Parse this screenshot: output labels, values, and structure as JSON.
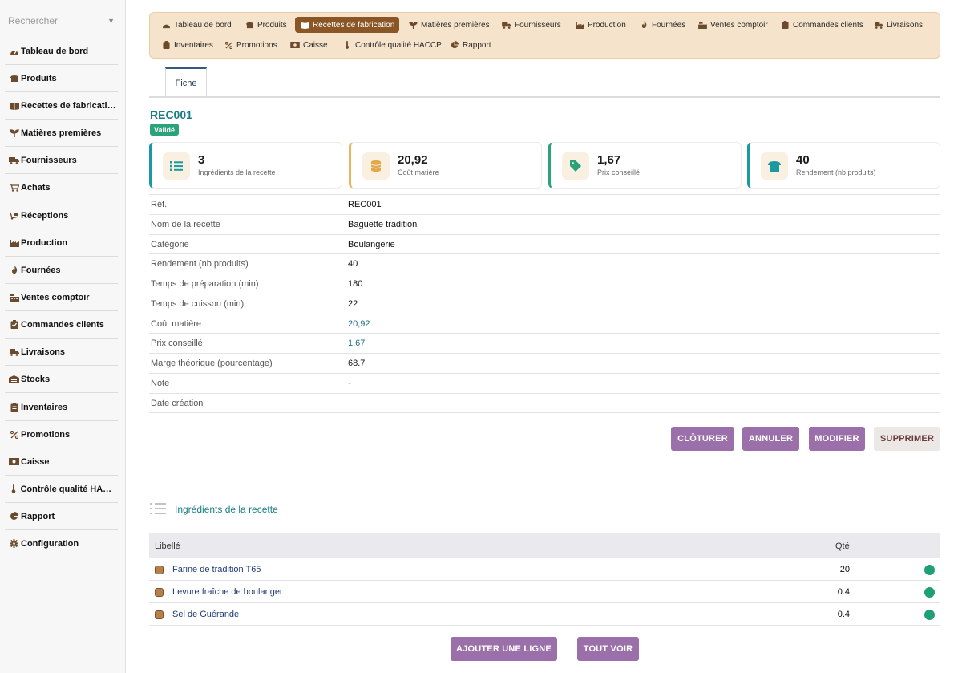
{
  "sidebar": {
    "search_placeholder": "Rechercher",
    "items": [
      {
        "label": "Tableau de bord",
        "icon": "dashboard-icon"
      },
      {
        "label": "Produits",
        "icon": "bread-icon"
      },
      {
        "label": "Recettes de fabrication",
        "icon": "book-icon"
      },
      {
        "label": "Matières premières",
        "icon": "seedling-icon"
      },
      {
        "label": "Fournisseurs",
        "icon": "truck-icon"
      },
      {
        "label": "Achats",
        "icon": "cart-icon"
      },
      {
        "label": "Réceptions",
        "icon": "dolly-icon"
      },
      {
        "label": "Production",
        "icon": "industry-icon"
      },
      {
        "label": "Fournées",
        "icon": "fire-icon"
      },
      {
        "label": "Ventes comptoir",
        "icon": "cash-register-icon"
      },
      {
        "label": "Commandes clients",
        "icon": "clipboard-check-icon"
      },
      {
        "label": "Livraisons",
        "icon": "shipping-fast-icon"
      },
      {
        "label": "Stocks",
        "icon": "warehouse-icon"
      },
      {
        "label": "Inventaires",
        "icon": "clipboard-list-icon"
      },
      {
        "label": "Promotions",
        "icon": "percent-icon"
      },
      {
        "label": "Caisse",
        "icon": "money-icon"
      },
      {
        "label": "Contrôle qualité HACCP",
        "icon": "thermometer-icon"
      },
      {
        "label": "Rapport",
        "icon": "chart-pie-icon"
      },
      {
        "label": "Configuration",
        "icon": "gear-icon"
      }
    ]
  },
  "topnav": {
    "items": [
      {
        "label": "Tableau de bord",
        "icon": "dashboard-icon"
      },
      {
        "label": "Produits",
        "icon": "bread-icon"
      },
      {
        "label": "Recettes de fabrication",
        "icon": "book-icon",
        "active": true
      },
      {
        "label": "Matières premières",
        "icon": "seedling-icon"
      },
      {
        "label": "Fournisseurs",
        "icon": "truck-icon"
      },
      {
        "label": "Production",
        "icon": "industry-icon"
      },
      {
        "label": "Fournées",
        "icon": "fire-icon"
      },
      {
        "label": "Ventes comptoir",
        "icon": "cash-register-icon"
      },
      {
        "label": "Commandes clients",
        "icon": "clipboard-check-icon"
      },
      {
        "label": "Livraisons",
        "icon": "shipping-fast-icon"
      },
      {
        "label": "Inventaires",
        "icon": "clipboard-list-icon"
      },
      {
        "label": "Promotions",
        "icon": "percent-icon"
      },
      {
        "label": "Caisse",
        "icon": "money-icon"
      },
      {
        "label": "Contrôle qualité HACCP",
        "icon": "thermometer-icon"
      },
      {
        "label": "Rapport",
        "icon": "chart-pie-icon"
      }
    ]
  },
  "tabs": {
    "fiche": "Fiche"
  },
  "record": {
    "ref": "REC001",
    "status": "Validé"
  },
  "kpis": [
    {
      "value": "3",
      "label": "Ingrédients de la recette",
      "icon": "list-icon",
      "accent": "#1a9aa0"
    },
    {
      "value": "20,92",
      "label": "Coût matière",
      "icon": "coins-icon",
      "accent": "#e8b560"
    },
    {
      "value": "1,67",
      "label": "Prix conseillé",
      "icon": "tag-icon",
      "accent": "#2aa27a"
    },
    {
      "value": "40",
      "label": "Rendement (nb produits)",
      "icon": "bread-icon",
      "accent": "#1a9aa0"
    }
  ],
  "details": [
    {
      "key": "Réf.",
      "value": "REC001"
    },
    {
      "key": "Nom de la recette",
      "value": "Baguette tradition"
    },
    {
      "key": "Catégorie",
      "value": "Boulangerie"
    },
    {
      "key": "Rendement (nb produits)",
      "value": "40"
    },
    {
      "key": "Temps de préparation (min)",
      "value": "180"
    },
    {
      "key": "Temps de cuisson (min)",
      "value": "22"
    },
    {
      "key": "Coût matière",
      "value": "20,92"
    },
    {
      "key": "Prix conseillé",
      "value": "1,67"
    },
    {
      "key": "Marge théorique (pourcentage)",
      "value": "68.7"
    },
    {
      "key": "Note",
      "value": "-"
    },
    {
      "key": "Date création",
      "value": ""
    }
  ],
  "actions": {
    "close": "CLÔTURER",
    "cancel": "ANNULER",
    "edit": "MODIFIER",
    "delete": "SUPPRIMER"
  },
  "ingredients": {
    "title": "Ingrédients de la recette",
    "columns": [
      "Libellé",
      "Qté"
    ],
    "rows": [
      {
        "name": "Farine de tradition T65",
        "qty": "20"
      },
      {
        "name": "Levure fraîche de boulanger",
        "qty": "0.4"
      },
      {
        "name": "Sel de Guérande",
        "qty": "0.4"
      }
    ],
    "add_label": "AJOUTER UNE LIGNE",
    "view_all_label": "TOUT VOIR"
  },
  "colors": {
    "nav_bg": "#f6e3cb",
    "nav_active": "#8a5626",
    "teal": "#1a7d86",
    "button": "#9b6fa9",
    "status_green": "#2aa27a"
  }
}
